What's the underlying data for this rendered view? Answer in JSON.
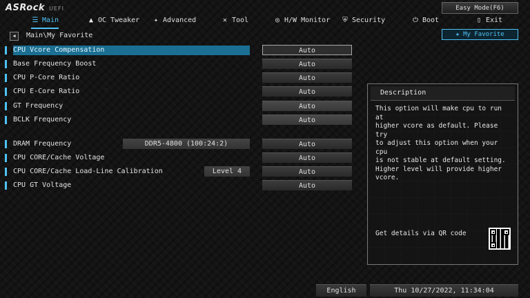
{
  "header": {
    "logo": "ASRock",
    "logo_sub": "UEFI",
    "easy_mode": "Easy Mode(F6)"
  },
  "nav": {
    "tabs": [
      {
        "label": "Main",
        "icon": "list-icon",
        "active": true
      },
      {
        "label": "OC Tweaker",
        "icon": "rocket-icon",
        "active": false
      },
      {
        "label": "Advanced",
        "icon": "star-icon",
        "active": false
      },
      {
        "label": "Tool",
        "icon": "tools-icon",
        "active": false
      },
      {
        "label": "H/W Monitor",
        "icon": "monitor-icon",
        "active": false
      },
      {
        "label": "Security",
        "icon": "shield-icon",
        "active": false
      },
      {
        "label": "Boot",
        "icon": "power-icon",
        "active": false
      },
      {
        "label": "Exit",
        "icon": "exit-door-icon",
        "active": false
      }
    ]
  },
  "breadcrumb": "Main\\My Favorite",
  "my_favorite": "My Favorite",
  "settings": [
    {
      "label": "CPU Vcore Compensation",
      "value": "Auto",
      "selected": true
    },
    {
      "label": "Base Frequency Boost",
      "value": "Auto"
    },
    {
      "label": "CPU P-Core Ratio",
      "value": "Auto"
    },
    {
      "label": "CPU E-Core Ratio",
      "value": "Auto"
    },
    {
      "label": "GT Frequency",
      "value": "Auto"
    },
    {
      "label": "BCLK Frequency",
      "value": "Auto"
    },
    {
      "label": "DRAM Frequency",
      "value": "Auto",
      "info": "DDR5-4800 (100:24:2)"
    },
    {
      "label": "CPU CORE/Cache Voltage",
      "value": "Auto"
    },
    {
      "label": "CPU CORE/Cache Load-Line Calibration",
      "value": "Auto",
      "info": "Level 4"
    },
    {
      "label": "CPU GT Voltage",
      "value": "Auto"
    }
  ],
  "description": {
    "title": "Description",
    "text": "This option will make cpu to run at\nhigher vcore as default. Please try\nto adjust this option when your cpu\nis not stable at default setting.\nHigher level will provide higher\nvcore.",
    "qr_text": "Get details via QR code"
  },
  "footer": {
    "language": "English",
    "datetime": "Thu 10/27/2022, 11:34:04"
  },
  "colors": {
    "accent": "#4fc3f7",
    "selection": "#1a6f92"
  }
}
